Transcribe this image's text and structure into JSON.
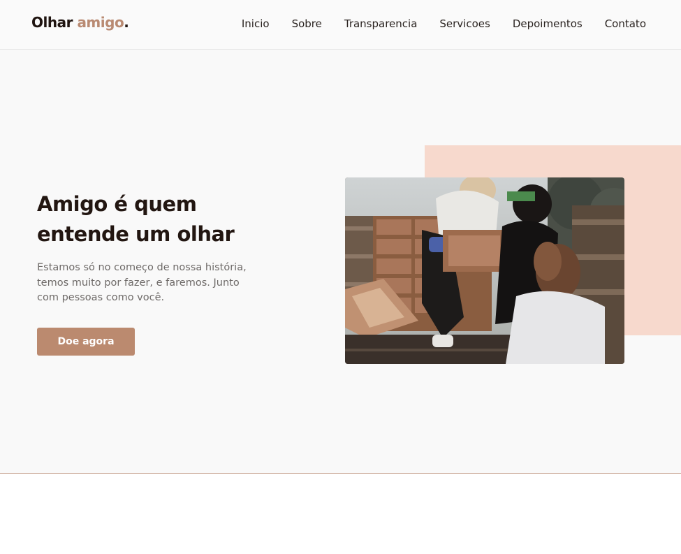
{
  "header": {
    "logo_main": "Olhar",
    "logo_accent": "amigo",
    "logo_dot": ".",
    "nav": [
      "Inicio",
      "Sobre",
      "Transparencia",
      "Servicoes",
      "Depoimentos",
      "Contato"
    ]
  },
  "hero": {
    "title": "Amigo é quem entende um olhar",
    "text": "Estamos só no começo de nossa história, temos muito por fazer, e faremos. Junto com pessoas como você.",
    "cta_label": "Doe agora"
  },
  "colors": {
    "brand_accent": "#bb8a6f",
    "pink_block": "#f7d9cd",
    "title": "#221611",
    "body_text": "#6e6a68",
    "hero_bg": "#f9f9f9"
  },
  "icons": {
    "photo": "volunteers-loading-food-boxes-photo"
  }
}
